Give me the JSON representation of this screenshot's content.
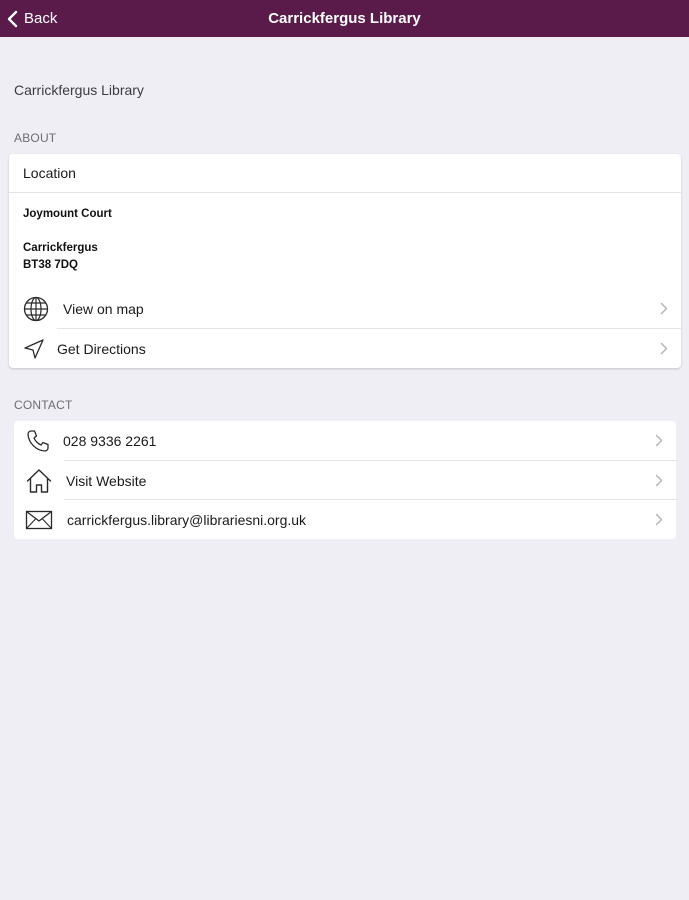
{
  "nav": {
    "back_label": "Back",
    "title": "Carrickfergus Library",
    "bar_color": "#5a1a4a"
  },
  "page": {
    "heading": "Carrickfergus Library"
  },
  "about": {
    "section_label": "ABOUT",
    "location_header": "Location",
    "address_line1": "Joymount Court",
    "address_town": "Carrickfergus",
    "address_postcode": "BT38 7DQ",
    "rows": [
      {
        "label": "View on map",
        "icon": "globe-icon"
      },
      {
        "label": "Get Directions",
        "icon": "navigation-arrow-icon"
      }
    ]
  },
  "contact": {
    "section_label": "CONTACT",
    "rows": [
      {
        "label": "028 9336 2261",
        "icon": "phone-icon"
      },
      {
        "label": "Visit Website",
        "icon": "house-icon"
      },
      {
        "label": "carrickfergus.library@librariesni.org.uk",
        "icon": "envelope-icon"
      }
    ]
  }
}
